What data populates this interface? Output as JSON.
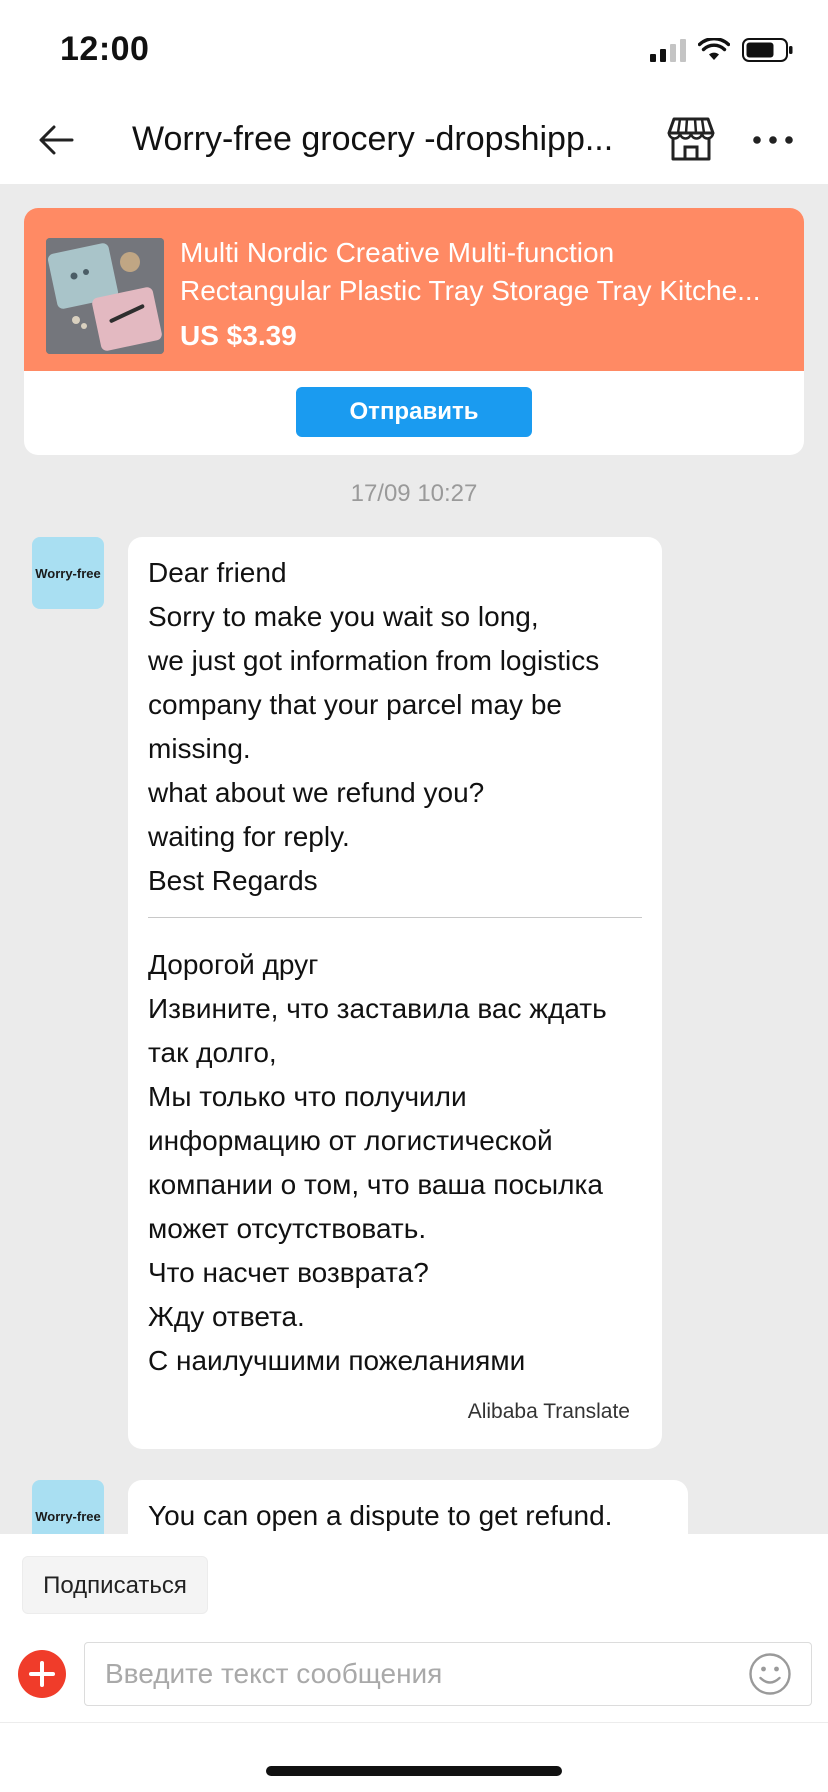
{
  "status_bar": {
    "time": "12:00",
    "icons": [
      "signal-icon",
      "wifi-icon",
      "battery-icon"
    ]
  },
  "header": {
    "back_icon": "arrow-left-icon",
    "title": "Worry-free grocery -dropshipp...",
    "store_icon": "store-icon",
    "more_icon": "more-dots-icon"
  },
  "product_card": {
    "title_line1": "Multi Nordic Creative Multi-function",
    "title_line2": "Rectangular Plastic Tray Storage Tray Kitche...",
    "price": "US $3.39",
    "send_label": "Отправить",
    "background_color": "#ff8a64",
    "button_color": "#1a9bf0"
  },
  "chat": {
    "timestamp": "17/09 10:27",
    "messages": [
      {
        "sender_avatar_label": "Worry-free",
        "text_en": [
          "Dear friend",
          "Sorry to make you wait so long,",
          "we just got information from logistics",
          "company that your parcel may be",
          "missing.",
          "what about we refund you?",
          "waiting for reply.",
          "Best Regards"
        ],
        "text_ru": [
          "Дорогой друг",
          "Извините, что заставила вас ждать",
          "так долго,",
          "Мы только что получили",
          "информацию от логистической",
          "компании о том, что ваша посылка",
          "может отсутствовать.",
          "Что насчет возврата?",
          "Жду ответа.",
          "С наилучшими пожеланиями"
        ],
        "translation_label": "Alibaba Translate"
      },
      {
        "sender_avatar_label": "Worry-free",
        "text": "You can open a dispute to get refund."
      }
    ]
  },
  "bottom": {
    "subscribe_label": "Подписаться",
    "add_icon": "plus-icon",
    "input_value": "",
    "input_placeholder": "Введите текст сообщения",
    "emoji_icon": "smiley-icon",
    "add_color": "#f03c2a"
  }
}
